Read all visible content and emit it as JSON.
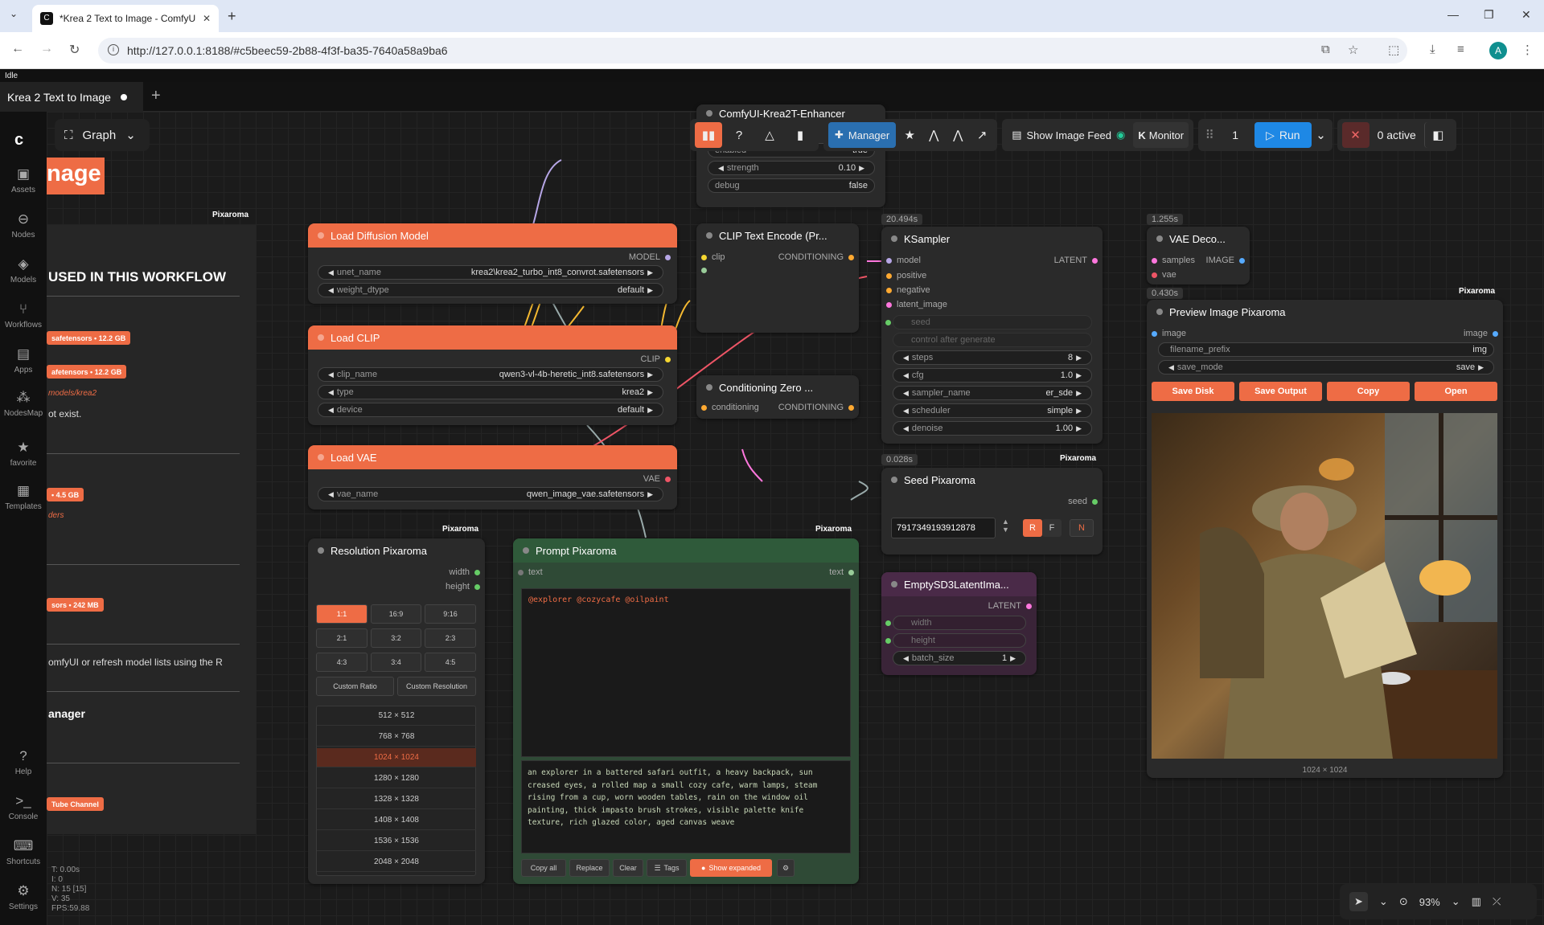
{
  "browser": {
    "tab_title": "*Krea 2 Text to Image - ComfyU",
    "url": "http://127.0.0.1:8188/#c5beec59-2b88-4f3f-ba35-7640a58a9ba6",
    "avatar": "A"
  },
  "status": "Idle",
  "workflow_tab": "Krea 2 Text to Image",
  "graph_button": "Graph",
  "sidebar": [
    {
      "label": "Assets",
      "icon": "image-icon"
    },
    {
      "label": "Nodes",
      "icon": "nodes-icon"
    },
    {
      "label": "Models",
      "icon": "models-icon"
    },
    {
      "label": "Workflows",
      "icon": "workflows-icon"
    },
    {
      "label": "Apps",
      "icon": "apps-icon"
    },
    {
      "label": "NodesMap",
      "icon": "nodesmap-icon"
    },
    {
      "label": "favorite",
      "icon": "star-icon"
    },
    {
      "label": "Templates",
      "icon": "templates-icon"
    },
    {
      "label": "Help",
      "icon": "help-icon"
    },
    {
      "label": "Console",
      "icon": "console-icon"
    },
    {
      "label": "Shortcuts",
      "icon": "keyboard-icon"
    },
    {
      "label": "Settings",
      "icon": "gear-icon"
    }
  ],
  "toolbar": {
    "manager": "Manager",
    "show_feed": "Show Image Feed",
    "monitor": "Monitor",
    "queue_count": "1",
    "run": "Run",
    "active": "0 active"
  },
  "info_panel": {
    "title_frag": "nage",
    "badge": "Pixaroma",
    "heading": "USED IN THIS WORKFLOW",
    "pill1": "safetensors  •  12.2 GB",
    "pill2": "afetensors  •  12.2 GB",
    "path": "models/krea2",
    "notexist": "ot exist.",
    "pill3": "  •  4.5 GB",
    "ders": "ders",
    "pill4": "sors  •  242 MB",
    "refresh": "omfyUI or refresh model lists using the R",
    "manager": "anager",
    "youtube": "Tube Channel"
  },
  "nodes": {
    "load_diffusion": {
      "title": "Load Diffusion Model",
      "out": "MODEL",
      "unet_label": "unet_name",
      "unet_val": "krea2\\krea2_turbo_int8_convrot.safetensors",
      "dtype_label": "weight_dtype",
      "dtype_val": "default"
    },
    "load_clip": {
      "title": "Load CLIP",
      "out": "CLIP",
      "clip_label": "clip_name",
      "clip_val": "qwen3-vl-4b-heretic_int8.safetensors",
      "type_label": "type",
      "type_val": "krea2",
      "device_label": "device",
      "device_val": "default"
    },
    "load_vae": {
      "title": "Load VAE",
      "out": "VAE",
      "vae_label": "vae_name",
      "vae_val": "qwen_image_vae.safetensors"
    },
    "enhancer": {
      "title": "ComfyUI-Krea2T-Enhancer",
      "enabled_label": "enabled",
      "enabled_val": "true",
      "strength_label": "strength",
      "strength_val": "0.10",
      "debug_label": "debug",
      "debug_val": "false"
    },
    "clip_encode": {
      "title": "CLIP Text Encode (Pr...",
      "in": "clip",
      "out": "CONDITIONING"
    },
    "cond_zero": {
      "title": "Conditioning Zero ...",
      "in": "conditioning",
      "out": "CONDITIONING"
    },
    "ksampler": {
      "time": "20.494s",
      "title": "KSampler",
      "in_model": "model",
      "in_pos": "positive",
      "in_neg": "negative",
      "in_latent": "latent_image",
      "out": "LATENT",
      "seed": "seed",
      "cag": "control after generate",
      "steps_l": "steps",
      "steps_v": "8",
      "cfg_l": "cfg",
      "cfg_v": "1.0",
      "sampler_l": "sampler_name",
      "sampler_v": "er_sde",
      "sched_l": "scheduler",
      "sched_v": "simple",
      "denoise_l": "denoise",
      "denoise_v": "1.00"
    },
    "vae_decode": {
      "time": "1.255s",
      "title": "VAE Deco...",
      "in_samples": "samples",
      "in_vae": "vae",
      "out": "IMAGE"
    },
    "preview": {
      "time": "0.430s",
      "badge": "Pixaroma",
      "title": "Preview Image Pixaroma",
      "in": "image",
      "out": "image",
      "prefix_label": "filename_prefix",
      "prefix_val": "img",
      "mode_label": "save_mode",
      "mode_val": "save",
      "btn_disk": "Save Disk",
      "btn_output": "Save Output",
      "btn_copy": "Copy",
      "btn_open": "Open",
      "dims": "1024 × 1024"
    },
    "seed": {
      "time": "0.028s",
      "badge": "Pixaroma",
      "title": "Seed Pixaroma",
      "out": "seed",
      "value": "791734919391287​8",
      "r": "R",
      "f": "F",
      "n": "N"
    },
    "empty_latent": {
      "title": "EmptySD3LatentIma...",
      "out": "LATENT",
      "width": "width",
      "height": "height",
      "batch_label": "batch_size",
      "batch_val": "1"
    },
    "resolution": {
      "badge": "Pixaroma",
      "title": "Resolution Pixaroma",
      "out_w": "width",
      "out_h": "height",
      "ratios": [
        "1:1",
        "16:9",
        "9:16",
        "2:1",
        "3:2",
        "2:3",
        "4:3",
        "3:4",
        "4:5"
      ],
      "custom_ratio": "Custom Ratio",
      "custom_res": "Custom Resolution",
      "sizes": [
        "512 × 512",
        "768 × 768",
        "1024 × 1024",
        "1280 × 1280",
        "1328 × 1328",
        "1408 × 1408",
        "1536 × 1536",
        "2048 × 2048"
      ],
      "selected_size": "1024 × 1024"
    },
    "prompt": {
      "badge": "Pixaroma",
      "title": "Prompt Pixaroma",
      "in": "text",
      "out": "text",
      "tags": "@explorer @cozycafe @oilpaint",
      "expanded": "an explorer in a battered safari outfit, a heavy backpack, sun creased eyes, a rolled map a small cozy cafe, warm lamps, steam rising from a cup, worn wooden tables, rain on the window oil painting, thick impasto brush strokes, visible palette knife texture, rich glazed color, aged canvas weave",
      "btn_copy": "Copy all",
      "btn_replace": "Replace",
      "btn_clear": "Clear",
      "btn_tags": "Tags",
      "btn_show": "Show expanded"
    }
  },
  "stats": [
    "T: 0.00s",
    "I: 0",
    "N: 15 [15]",
    "V: 35",
    "FPS:59.88"
  ],
  "zoom": "93%"
}
